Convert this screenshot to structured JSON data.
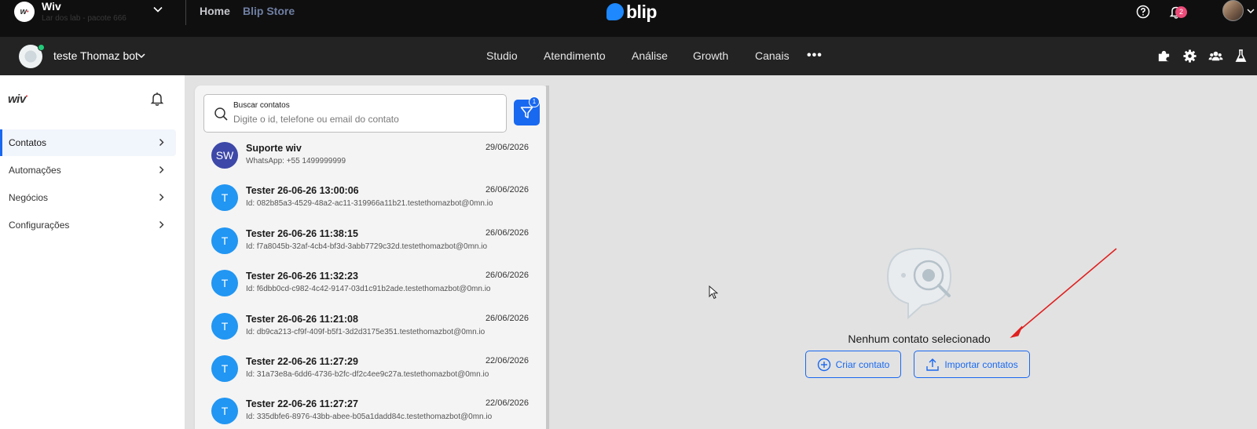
{
  "topbar": {
    "org_name": "Wiv",
    "org_sub": "Lar dos lab - pacote 666",
    "home": "Home",
    "store": "Blip Store",
    "brand": "blip",
    "notifications_count": "2"
  },
  "botbar": {
    "bot_name": "teste Thomaz bot",
    "nav": [
      "Studio",
      "Atendimento",
      "Análise",
      "Growth",
      "Canais"
    ],
    "more": "•••"
  },
  "sidebar": {
    "logo": "wiv",
    "items": [
      {
        "label": "Contatos"
      },
      {
        "label": "Automações"
      },
      {
        "label": "Negócios"
      },
      {
        "label": "Configurações"
      }
    ]
  },
  "search": {
    "label": "Buscar contatos",
    "placeholder": "Digite o id, telefone ou email do contato",
    "filter_count": "1"
  },
  "contacts": [
    {
      "initials": "SW",
      "name": "Suporte wiv",
      "sub": "WhatsApp: +55 1499999999",
      "date": "29/06/2026"
    },
    {
      "initials": "T",
      "name": "Tester 26-06-26 13:00:06",
      "sub": "Id: 082b85a3-4529-48a2-ac11-319966a11b21.testethomazbot@0mn.io",
      "date": "26/06/2026"
    },
    {
      "initials": "T",
      "name": "Tester 26-06-26 11:38:15",
      "sub": "Id: f7a8045b-32af-4cb4-bf3d-3abb7729c32d.testethomazbot@0mn.io",
      "date": "26/06/2026"
    },
    {
      "initials": "T",
      "name": "Tester 26-06-26 11:32:23",
      "sub": "Id: f6dbb0cd-c982-4c42-9147-03d1c91b2ade.testethomazbot@0mn.io",
      "date": "26/06/2026"
    },
    {
      "initials": "T",
      "name": "Tester 26-06-26 11:21:08",
      "sub": "Id: db9ca213-cf9f-409f-b5f1-3d2d3175e351.testethomazbot@0mn.io",
      "date": "26/06/2026"
    },
    {
      "initials": "T",
      "name": "Tester 22-06-26 11:27:29",
      "sub": "Id: 31a73e8a-6dd6-4736-b2fc-df2c4ee9c27a.testethomazbot@0mn.io",
      "date": "22/06/2026"
    },
    {
      "initials": "T",
      "name": "Tester 22-06-26 11:27:27",
      "sub": "Id: 335dbfe6-8976-43bb-abee-b05a1dadd84c.testethomazbot@0mn.io",
      "date": "22/06/2026"
    }
  ],
  "empty_state": {
    "title": "Nenhum contato selecionado",
    "create_label": "Criar contato",
    "import_label": "Importar contatos"
  },
  "colors": {
    "primary": "#1968f0",
    "brand_blue": "#1e88ff",
    "badge_pink": "#ec4b79",
    "online_green": "#21cc79",
    "annotation_red": "#e02020"
  }
}
